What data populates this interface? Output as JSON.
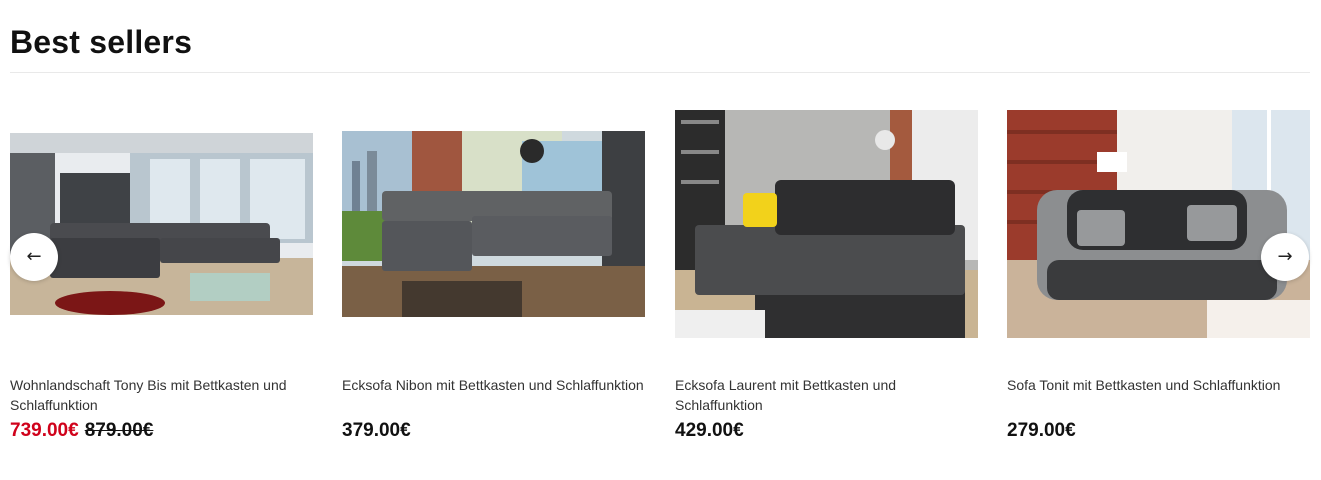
{
  "section": {
    "title": "Best sellers"
  },
  "carousel": {
    "prev_icon": "arrow-left-icon",
    "next_icon": "arrow-right-icon",
    "prev_glyph": "←",
    "next_glyph": "→"
  },
  "products": [
    {
      "name": "Wohnlandschaft Tony Bis mit Bettkasten und Schlaffunktion",
      "price": "739.00€",
      "old_price": "879.00€",
      "on_sale": true
    },
    {
      "name": "Ecksofa Nibon mit Bettkasten und Schlaffunktion",
      "price": "379.00€"
    },
    {
      "name": "Ecksofa Laurent mit Bettkasten und Schlaffunktion",
      "price": "429.00€"
    },
    {
      "name": "Sofa Tonit mit Bettkasten und Schlaffunktion",
      "price": "279.00€"
    }
  ],
  "colors": {
    "sale_price": "#d0021b",
    "text": "#111111",
    "divider": "#e9e9e9"
  }
}
